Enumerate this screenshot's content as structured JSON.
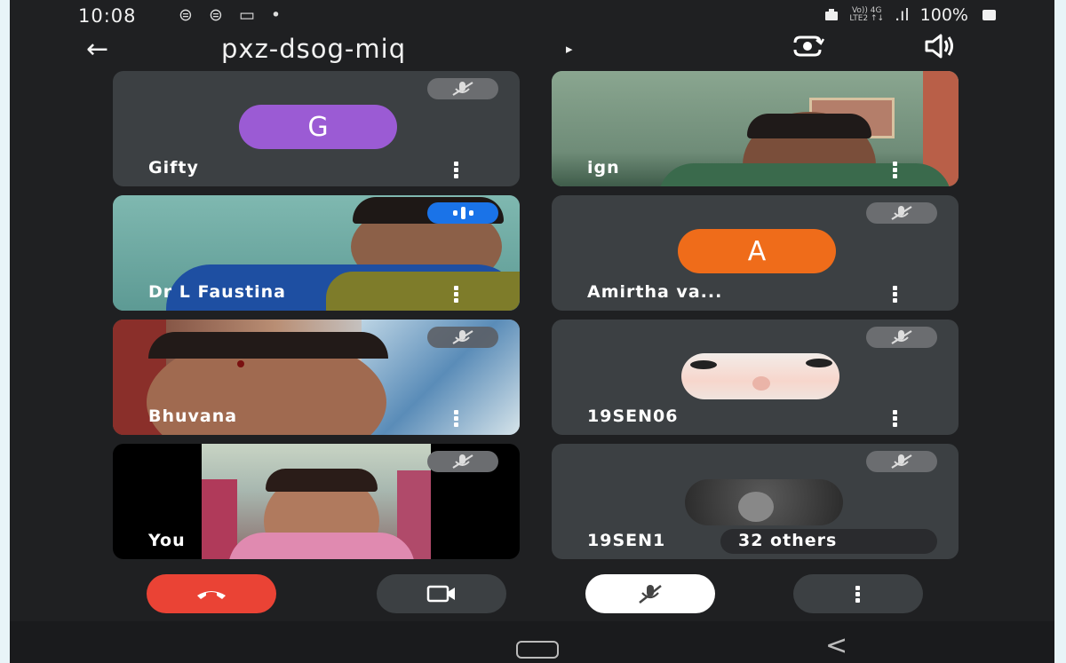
{
  "status_bar": {
    "time": "10:08",
    "left_icons": "⊜ ⊜ ▭ •",
    "network_top": "Vo)) 4G",
    "network_bottom": "LTE2 ↑↓",
    "signal": ".ıl",
    "battery": "100%"
  },
  "header": {
    "meeting_code": "pxz-dsog-miq",
    "caret": "▸",
    "back_icon": "←"
  },
  "participants": [
    {
      "name": "Gifty",
      "avatar_letter": "G",
      "avatar_color": "#9b5bd4",
      "muted": true,
      "type": "letter"
    },
    {
      "name": "ign",
      "muted": false,
      "type": "video"
    },
    {
      "name": "Dr L Faustina",
      "muted": false,
      "speaking": true,
      "type": "video"
    },
    {
      "name": "Amirtha va...",
      "avatar_letter": "A",
      "avatar_color": "#ef6c1a",
      "muted": true,
      "type": "letter"
    },
    {
      "name": "Bhuvana",
      "muted": true,
      "type": "video"
    },
    {
      "name": "19SEN06",
      "muted": true,
      "type": "photo"
    },
    {
      "name": "You",
      "muted": true,
      "type": "video"
    },
    {
      "name": "19SEN1",
      "muted": true,
      "type": "photo"
    }
  ],
  "others_label": "32 others",
  "controls": {
    "end_call_color": "#ea4335",
    "camera_bg": "#3c4043",
    "mic_bg": "#ffffff",
    "more_bg": "#3c4043"
  },
  "nav": {
    "back_glyph": "<"
  }
}
